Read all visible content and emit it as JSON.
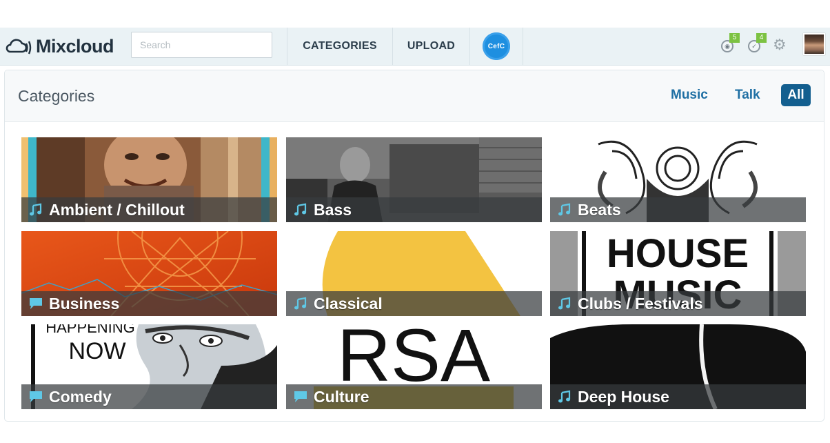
{
  "header": {
    "logo_text": "Mixcloud",
    "search": {
      "placeholder": "Search",
      "value": ""
    },
    "nav": [
      {
        "label": "CATEGORIES"
      },
      {
        "label": "UPLOAD"
      }
    ],
    "badge_text": "CefC",
    "stats": [
      {
        "icon": "listens-icon",
        "count": "5"
      },
      {
        "icon": "favorites-icon",
        "count": "4"
      }
    ]
  },
  "categories_panel": {
    "title": "Categories",
    "filters": [
      {
        "label": "Music",
        "active": false
      },
      {
        "label": "Talk",
        "active": false
      },
      {
        "label": "All",
        "active": true
      }
    ],
    "tiles": [
      {
        "label": "Ambient / Chillout",
        "type": "music-note-icon"
      },
      {
        "label": "Bass",
        "type": "music-note-icon"
      },
      {
        "label": "Beats",
        "type": "music-note-icon"
      },
      {
        "label": "Business",
        "type": "speech-bubble-icon"
      },
      {
        "label": "Classical",
        "type": "music-note-icon"
      },
      {
        "label": "Clubs / Festivals",
        "type": "music-note-icon"
      },
      {
        "label": "Comedy",
        "type": "speech-bubble-icon"
      },
      {
        "label": "Culture",
        "type": "speech-bubble-icon"
      },
      {
        "label": "Deep House",
        "type": "music-note-icon"
      }
    ],
    "tile_art_text": {
      "house_music": [
        "HOUSE",
        "MUSIC"
      ],
      "comedy": [
        "HAPPENING",
        "NOW"
      ],
      "culture": "RSA"
    }
  },
  "colors": {
    "accent": "#135f8f",
    "nav_background": "#eaf2f5",
    "count_badge": "#7cc242",
    "icon_teal": "#5fc8e6"
  }
}
